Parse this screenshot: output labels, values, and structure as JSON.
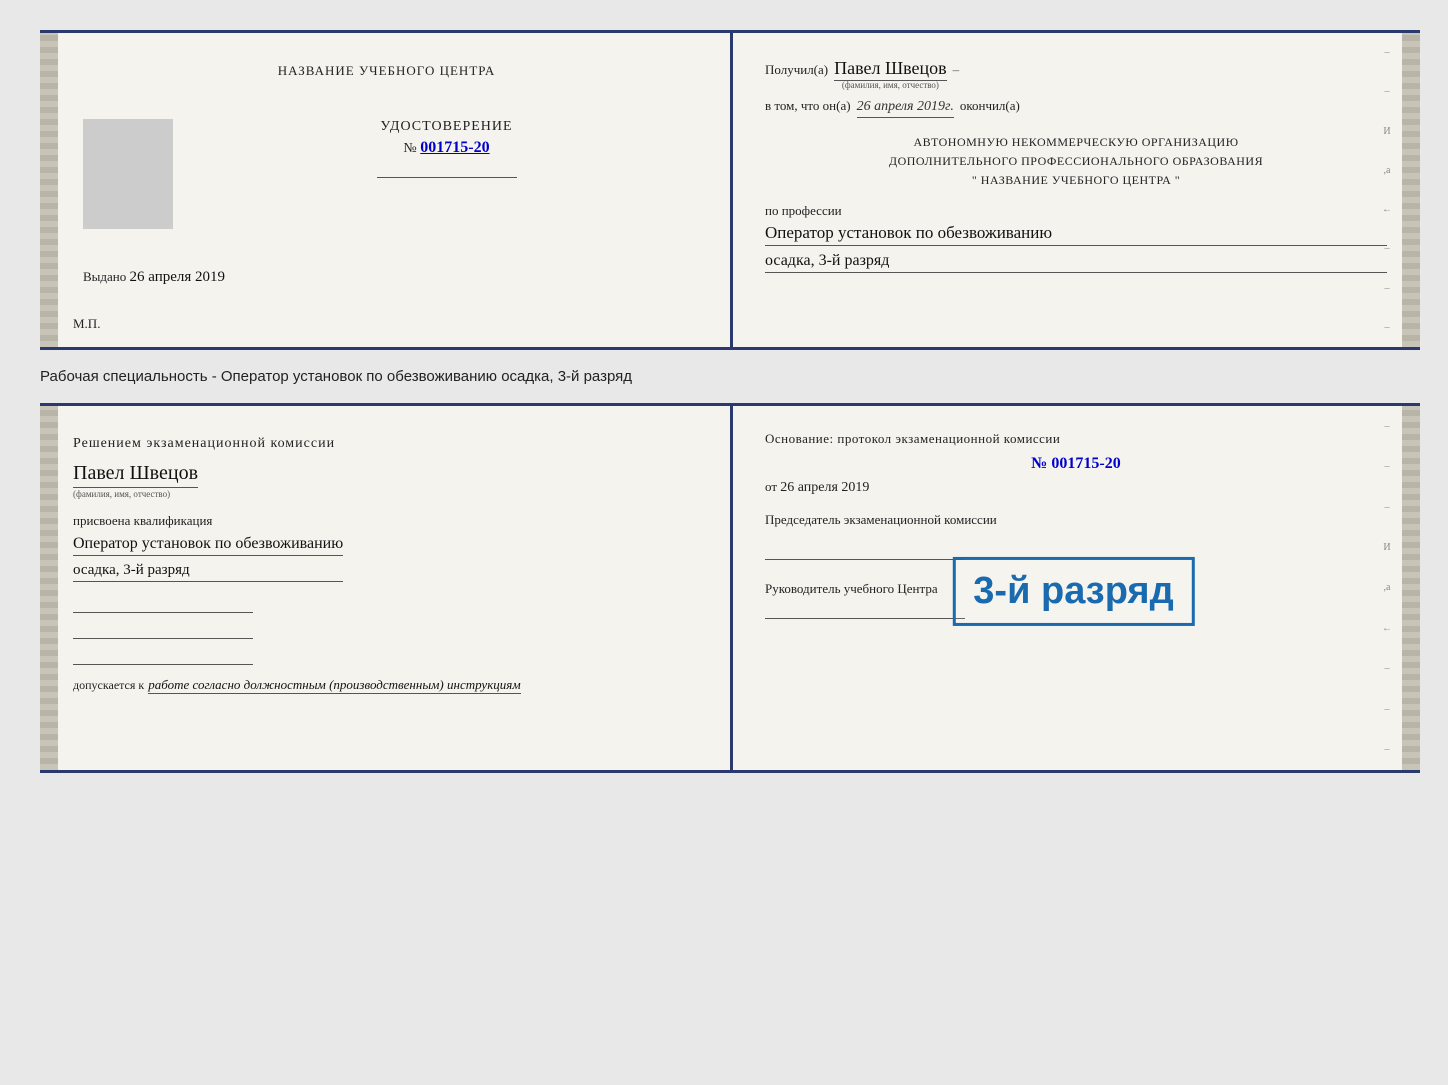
{
  "page": {
    "background": "#e8e8e8"
  },
  "subtitle": "Рабочая специальность - Оператор установок по обезвоживанию осадка, 3-й разряд",
  "doc1": {
    "left": {
      "center_title": "НАЗВАНИЕ УЧЕБНОГО ЦЕНТРА",
      "udostoverenie_label": "УДОСТОВЕРЕНИЕ",
      "number_prefix": "№",
      "number": "001715-20",
      "vydano_label": "Выдано",
      "vydano_date": "26 апреля 2019",
      "mp_label": "М.П."
    },
    "right": {
      "poluchil_label": "Получил(а)",
      "recipient_name": "Павел Швецов",
      "fio_sub": "(фамилия, имя, отчество)",
      "dash": "–",
      "vtom_label": "в том, что он(а)",
      "vtom_date": "26 апреля 2019г.",
      "okonchil_label": "окончил(а)",
      "org_line1": "АВТОНОМНУЮ НЕКОММЕРЧЕСКУЮ ОРГАНИЗАЦИЮ",
      "org_line2": "ДОПОЛНИТЕЛЬНОГО ПРОФЕССИОНАЛЬНОГО ОБРАЗОВАНИЯ",
      "org_line3": "\"    НАЗВАНИЕ УЧЕБНОГО ЦЕНТРА    \"",
      "po_professii": "по профессии",
      "profession": "Оператор установок по обезвоживанию",
      "razryad": "осадка, 3-й разряд"
    }
  },
  "doc2": {
    "left": {
      "resheniem_label": "Решением экзаменационной комиссии",
      "recipient_name": "Павел Швецов",
      "fio_sub": "(фамилия, имя, отчество)",
      "prisvoena_label": "присвоена квалификация",
      "profession_line1": "Оператор установок по обезвоживанию",
      "profession_line2": "осадка, 3-й разряд",
      "dopuskaetsya_label": "допускается к",
      "dopuskaetsya_value": "работе согласно должностным (производственным) инструкциям"
    },
    "right": {
      "osnovanie_label": "Основание: протокол экзаменационной комиссии",
      "number_prefix": "№",
      "number": "001715-20",
      "ot_prefix": "от",
      "ot_date": "26 апреля 2019",
      "predsedatel_label": "Председатель экзаменационной комиссии",
      "rukovoditel_label": "Руководитель учебного Центра"
    },
    "stamp": {
      "text": "3-й разряд"
    }
  },
  "right_decorations": {
    "chars": [
      "И",
      ",а",
      "←",
      "–",
      "–",
      "–"
    ]
  }
}
